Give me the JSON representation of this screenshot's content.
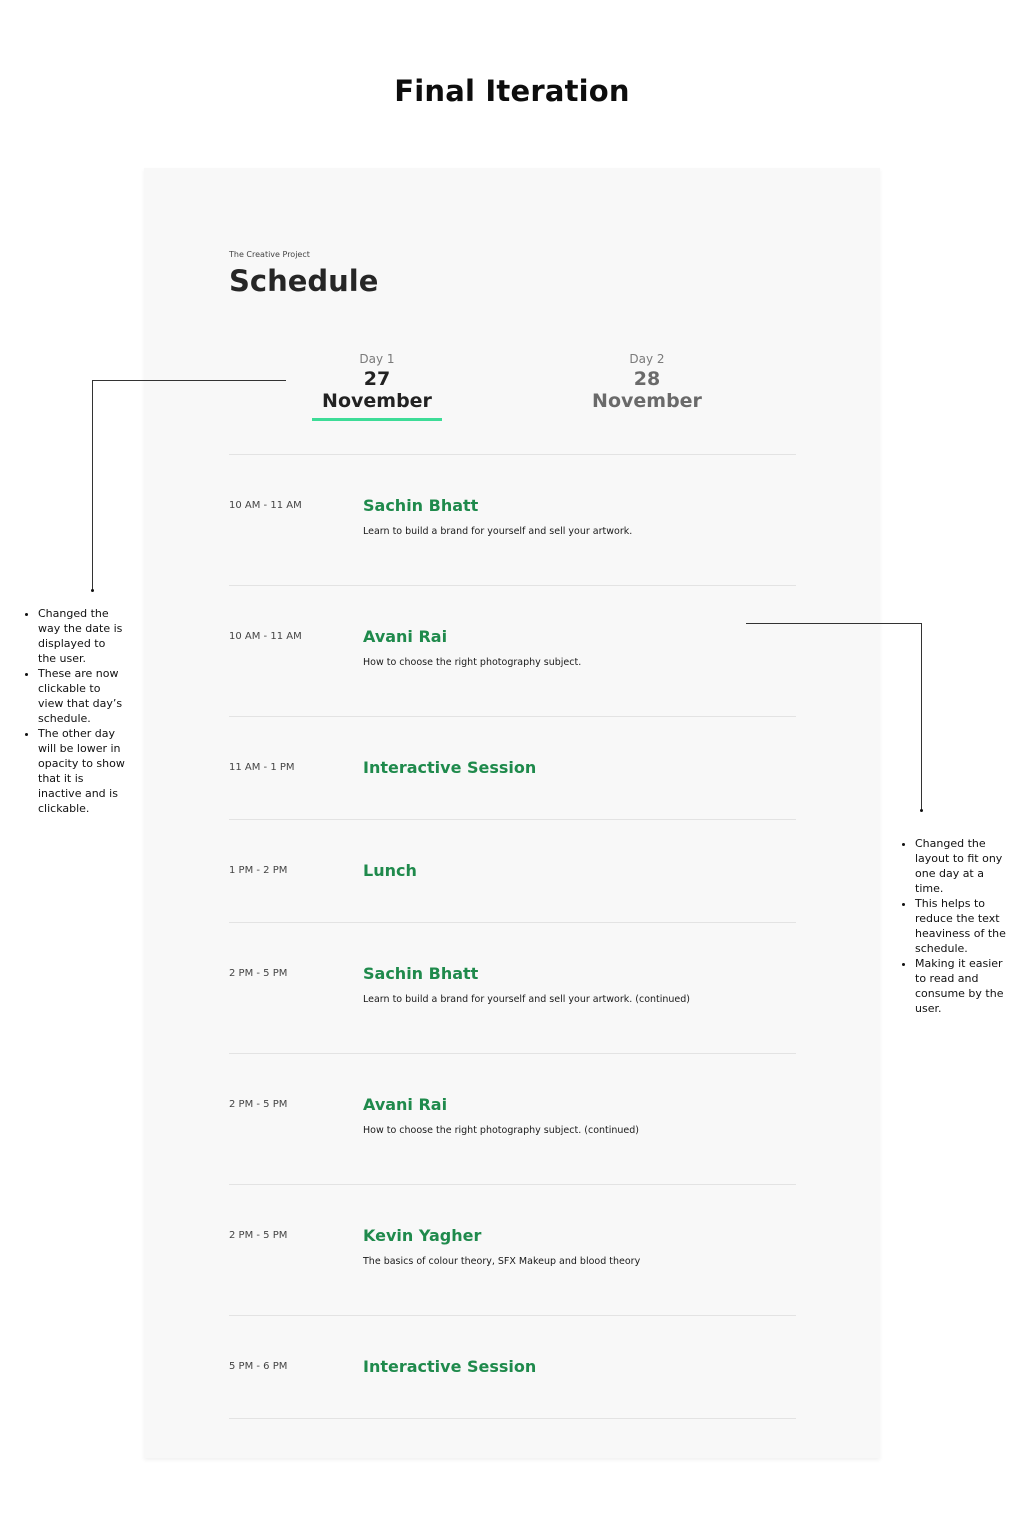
{
  "page": {
    "title": "Final Iteration"
  },
  "card": {
    "project": "The Creative Project",
    "heading": "Schedule",
    "tabs": [
      {
        "label": "Day 1",
        "date": "27 November",
        "active": true
      },
      {
        "label": "Day 2",
        "date": "28 November",
        "active": false
      }
    ],
    "accent_color": "#3ddc97",
    "title_color": "#1f8a4c",
    "sessions": [
      {
        "time": "10 AM - 11 AM",
        "title": "Sachin Bhatt",
        "desc": "Learn to build a brand for yourself and sell your artwork."
      },
      {
        "time": "10 AM - 11 AM",
        "title": "Avani Rai",
        "desc": "How to choose the right photography subject."
      },
      {
        "time": "11 AM - 1 PM",
        "title": "Interactive Session",
        "desc": ""
      },
      {
        "time": "1 PM - 2 PM",
        "title": "Lunch",
        "desc": ""
      },
      {
        "time": "2 PM - 5 PM",
        "title": "Sachin Bhatt",
        "desc": "Learn to build a brand for yourself and sell your artwork. (continued)"
      },
      {
        "time": "2 PM - 5 PM",
        "title": "Avani Rai",
        "desc": "How to choose the right photography subject. (continued)"
      },
      {
        "time": "2 PM - 5 PM",
        "title": "Kevin Yagher",
        "desc": "The basics of colour theory, SFX Makeup and blood theory"
      },
      {
        "time": "5 PM - 6 PM",
        "title": "Interactive Session",
        "desc": ""
      }
    ]
  },
  "notes": {
    "left": [
      "Changed the way the date is displayed to the user.",
      "These are now clickable to view that day’s schedule.",
      "The other day will be lower in opacity to show that it is inactive and is clickable."
    ],
    "right": [
      "Changed the layout to fit ony one day at a time.",
      "This helps to reduce the text heaviness of the schedule.",
      "Making it easier to read and consume by the user."
    ]
  }
}
